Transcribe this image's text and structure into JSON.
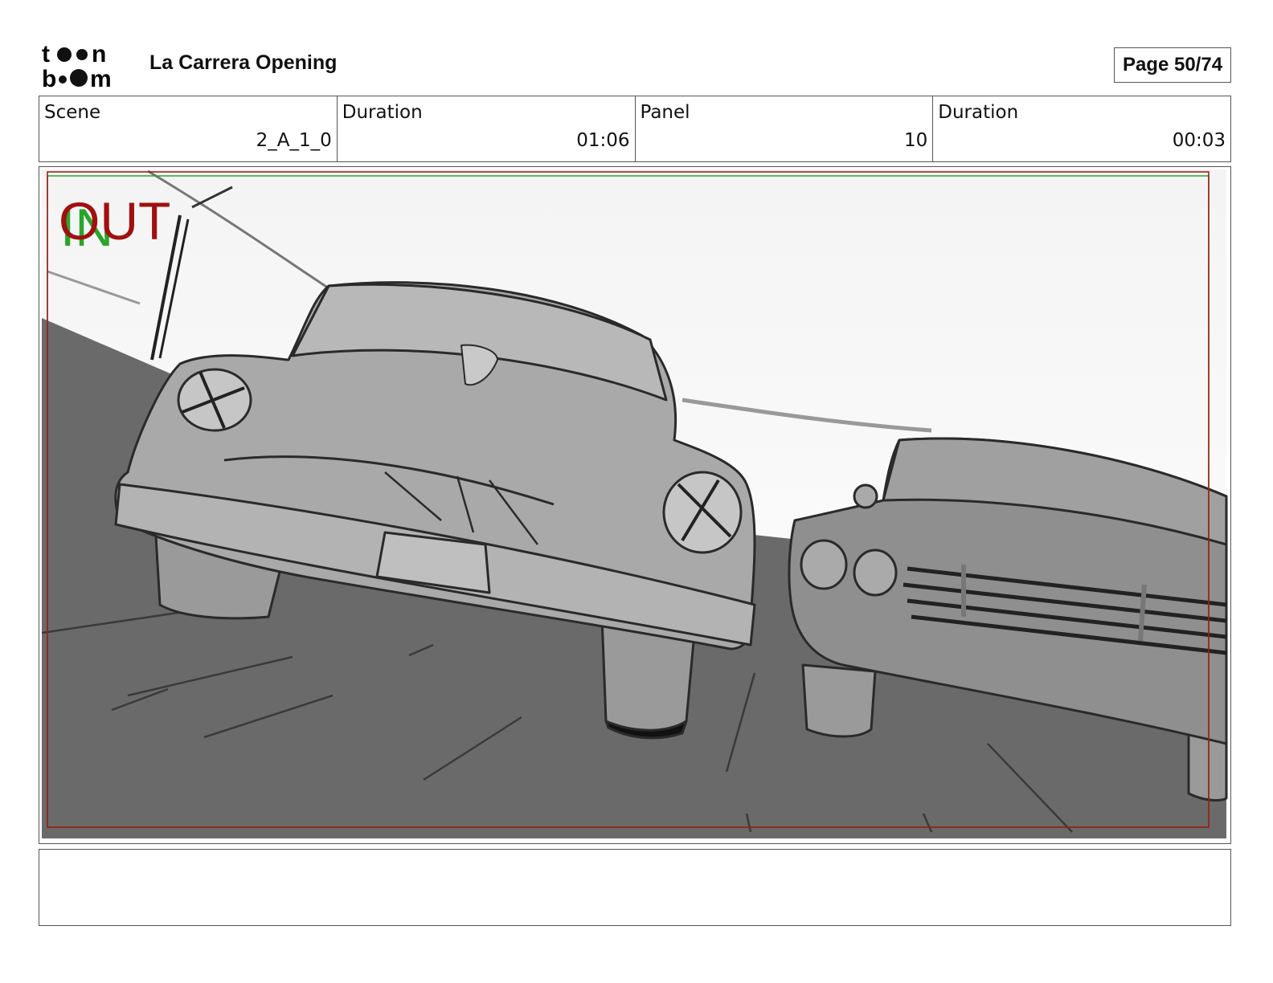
{
  "header": {
    "logo_text_top": "toon",
    "logo_text_bottom": "boom",
    "project_title": "La Carrera Opening",
    "page_label": "Page 50/74"
  },
  "info": [
    {
      "label": "Scene",
      "value": "2_A_1_0"
    },
    {
      "label": "Duration",
      "value": "01:06"
    },
    {
      "label": "Panel",
      "value": "10"
    },
    {
      "label": "Duration",
      "value": "00:03"
    }
  ],
  "panel": {
    "in_label": "IN",
    "out_label": "OUT",
    "in_color": "#2aa52a",
    "out_color": "#a01010"
  },
  "notes": ""
}
